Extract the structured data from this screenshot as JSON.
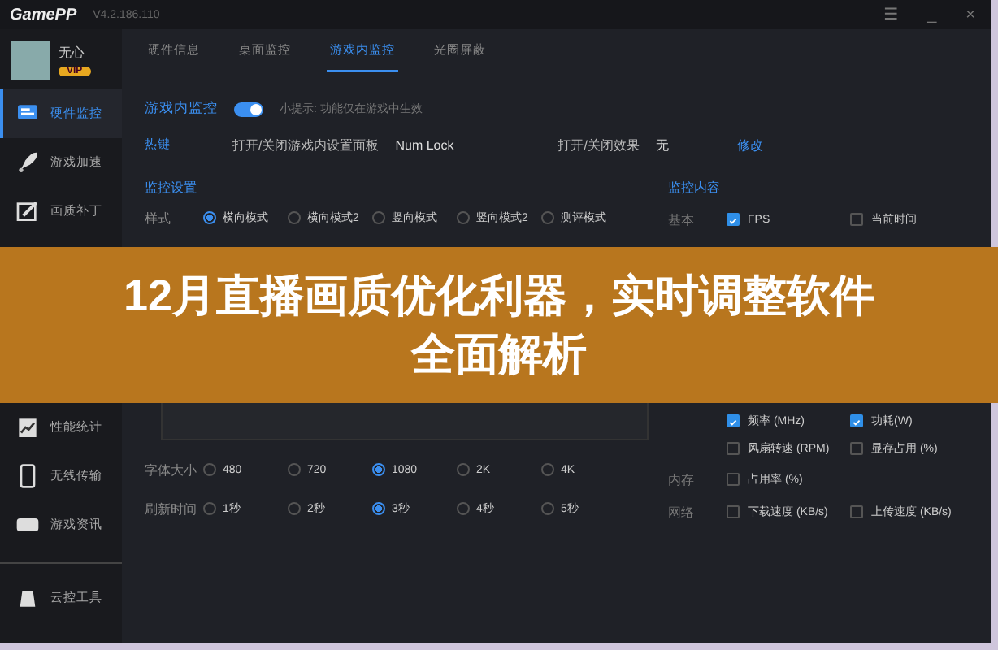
{
  "title_bar": {
    "logo": "GamePP",
    "version": "V4.2.186.110",
    "buttons": [
      "☰",
      "_",
      "×"
    ]
  },
  "user": {
    "name": "无心",
    "badge": "VIP"
  },
  "sidebar": {
    "items": [
      {
        "label": "硬件监控",
        "selected": true
      },
      {
        "label": "游戏加速",
        "selected": false
      },
      {
        "label": "画质补丁",
        "selected": false
      }
    ],
    "lower_items": [
      {
        "label": "性能统计",
        "selected": false
      },
      {
        "label": "无线传输",
        "selected": false
      },
      {
        "label": "游戏资讯",
        "selected": false
      }
    ],
    "footer_item": {
      "label": "云控工具",
      "selected": false
    }
  },
  "tabs": [
    {
      "label": "硬件信息",
      "selected": false
    },
    {
      "label": "桌面监控",
      "selected": false
    },
    {
      "label": "游戏内监控",
      "selected": true
    },
    {
      "label": "光圈屏蔽",
      "selected": false
    }
  ],
  "monitor_toggle": {
    "label": "游戏内监控",
    "on": true,
    "hint": "小提示: 功能仅在游戏中生效"
  },
  "hotkeys": {
    "label": "热键",
    "panel_label": "打开/关闭游戏内设置面板",
    "panel_key": "Num Lock",
    "effect_label": "打开/关闭效果",
    "effect_key": "无",
    "edit_link": "修改"
  },
  "settings": {
    "title": "监控设置",
    "style": {
      "label": "样式",
      "options": [
        {
          "label": "横向模式",
          "selected": true
        },
        {
          "label": "横向模式2",
          "selected": false
        },
        {
          "label": "竖向模式",
          "selected": false
        },
        {
          "label": "竖向模式2",
          "selected": false
        },
        {
          "label": "测评模式",
          "selected": false
        }
      ]
    },
    "font_size": {
      "label": "字体大小",
      "options": [
        {
          "label": "480",
          "selected": false
        },
        {
          "label": "720",
          "selected": false
        },
        {
          "label": "1080",
          "selected": true
        },
        {
          "label": "2K",
          "selected": false
        },
        {
          "label": "4K",
          "selected": false
        }
      ]
    },
    "refresh": {
      "label": "刷新时间",
      "options": [
        {
          "label": "1秒",
          "selected": false
        },
        {
          "label": "2秒",
          "selected": false
        },
        {
          "label": "3秒",
          "selected": true
        },
        {
          "label": "4秒",
          "selected": false
        },
        {
          "label": "5秒",
          "selected": false
        }
      ]
    }
  },
  "content": {
    "title": "监控内容",
    "groups": [
      {
        "label": "基本",
        "items": [
          {
            "label": "FPS",
            "checked": true
          },
          {
            "label": "当前时间",
            "checked": false
          }
        ]
      }
    ],
    "lower_groups": [
      {
        "items": [
          {
            "label": "频率 (MHz)",
            "checked": true
          },
          {
            "label": "功耗(W)",
            "checked": true
          },
          {
            "label": "风扇转速 (RPM)",
            "checked": false
          },
          {
            "label": "显存占用 (%)",
            "checked": false
          }
        ]
      },
      {
        "label": "内存",
        "items": [
          {
            "label": "占用率 (%)",
            "checked": false
          }
        ]
      },
      {
        "label": "网络",
        "items": [
          {
            "label": "下载速度 (KB/s)",
            "checked": false
          },
          {
            "label": "上传速度 (KB/s)",
            "checked": false
          }
        ]
      }
    ]
  },
  "banner": {
    "lines": [
      "12月直播画质优化利器，实时调整软件",
      "全面解析"
    ]
  }
}
